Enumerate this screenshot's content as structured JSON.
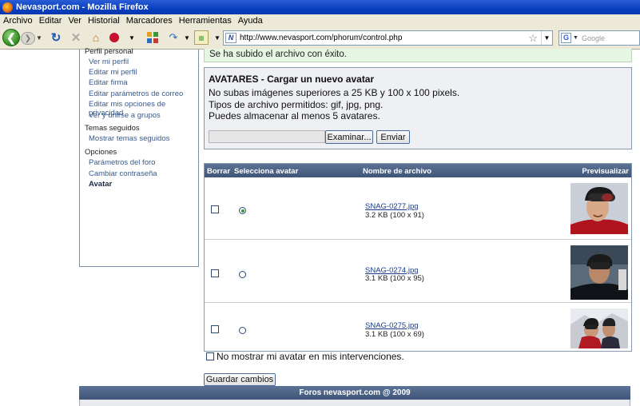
{
  "window": {
    "title": "Nevasport.com - Mozilla Firefox"
  },
  "menu": [
    "Archivo",
    "Editar",
    "Ver",
    "Historial",
    "Marcadores",
    "Herramientas",
    "Ayuda"
  ],
  "toolbar": {
    "url": "http://www.nevasport.com/phorum/control.php",
    "search_placeholder": "Google",
    "site_icon_letter": "N",
    "search_engine_letter": "G"
  },
  "sidebar": {
    "sections": [
      {
        "heading": "Perfil personal",
        "items": [
          "Ver mi perfil",
          "Editar mi perfil",
          "Editar firma",
          "Editar parámetros de correo",
          "Editar mis opciones de privacidad",
          "Ver y unirse a grupos"
        ]
      },
      {
        "heading": "Temas seguidos",
        "items": [
          "Mostrar temas seguidos"
        ]
      },
      {
        "heading": "Opciones",
        "items": [
          "Parámetros del foro",
          "Cambiar contraseña",
          "Avatar"
        ]
      }
    ]
  },
  "success_message": "Se ha subido el archivo con éxito.",
  "upload": {
    "title": "AVATARES - Cargar un nuevo avatar",
    "line1": "No subas imágenes superiores a 25 KB y 100 x 100 pixels.",
    "line2": "Tipos de archivo permitidos: gif, jpg, png.",
    "line3": "Puedes almacenar al menos 5 avatares.",
    "browse_label": "Examinar...",
    "send_label": "Enviar"
  },
  "table": {
    "headers": {
      "delete": "Borrar",
      "select": "Selecciona avatar",
      "filename": "Nombre de archivo",
      "preview": "Previsualizar"
    },
    "rows": [
      {
        "filename": "SNAG-0277.jpg",
        "size": "3.2 KB (100 x 91)",
        "selected": true
      },
      {
        "filename": "SNAG-0274.jpg",
        "size": "3.1 KB (100 x 95)",
        "selected": false
      },
      {
        "filename": "SNAG-0275.jpg",
        "size": "3.1 KB (100 x 69)",
        "selected": false
      }
    ]
  },
  "no_show_label": "No mostrar mi avatar en mis intervenciones.",
  "save_label": "Guardar cambios",
  "footer": "Foros nevasport.com @ 2009",
  "colors": {
    "header_bar": "#4a6187",
    "success_bg": "#e5f6e2",
    "link": "#3a5a8c"
  }
}
